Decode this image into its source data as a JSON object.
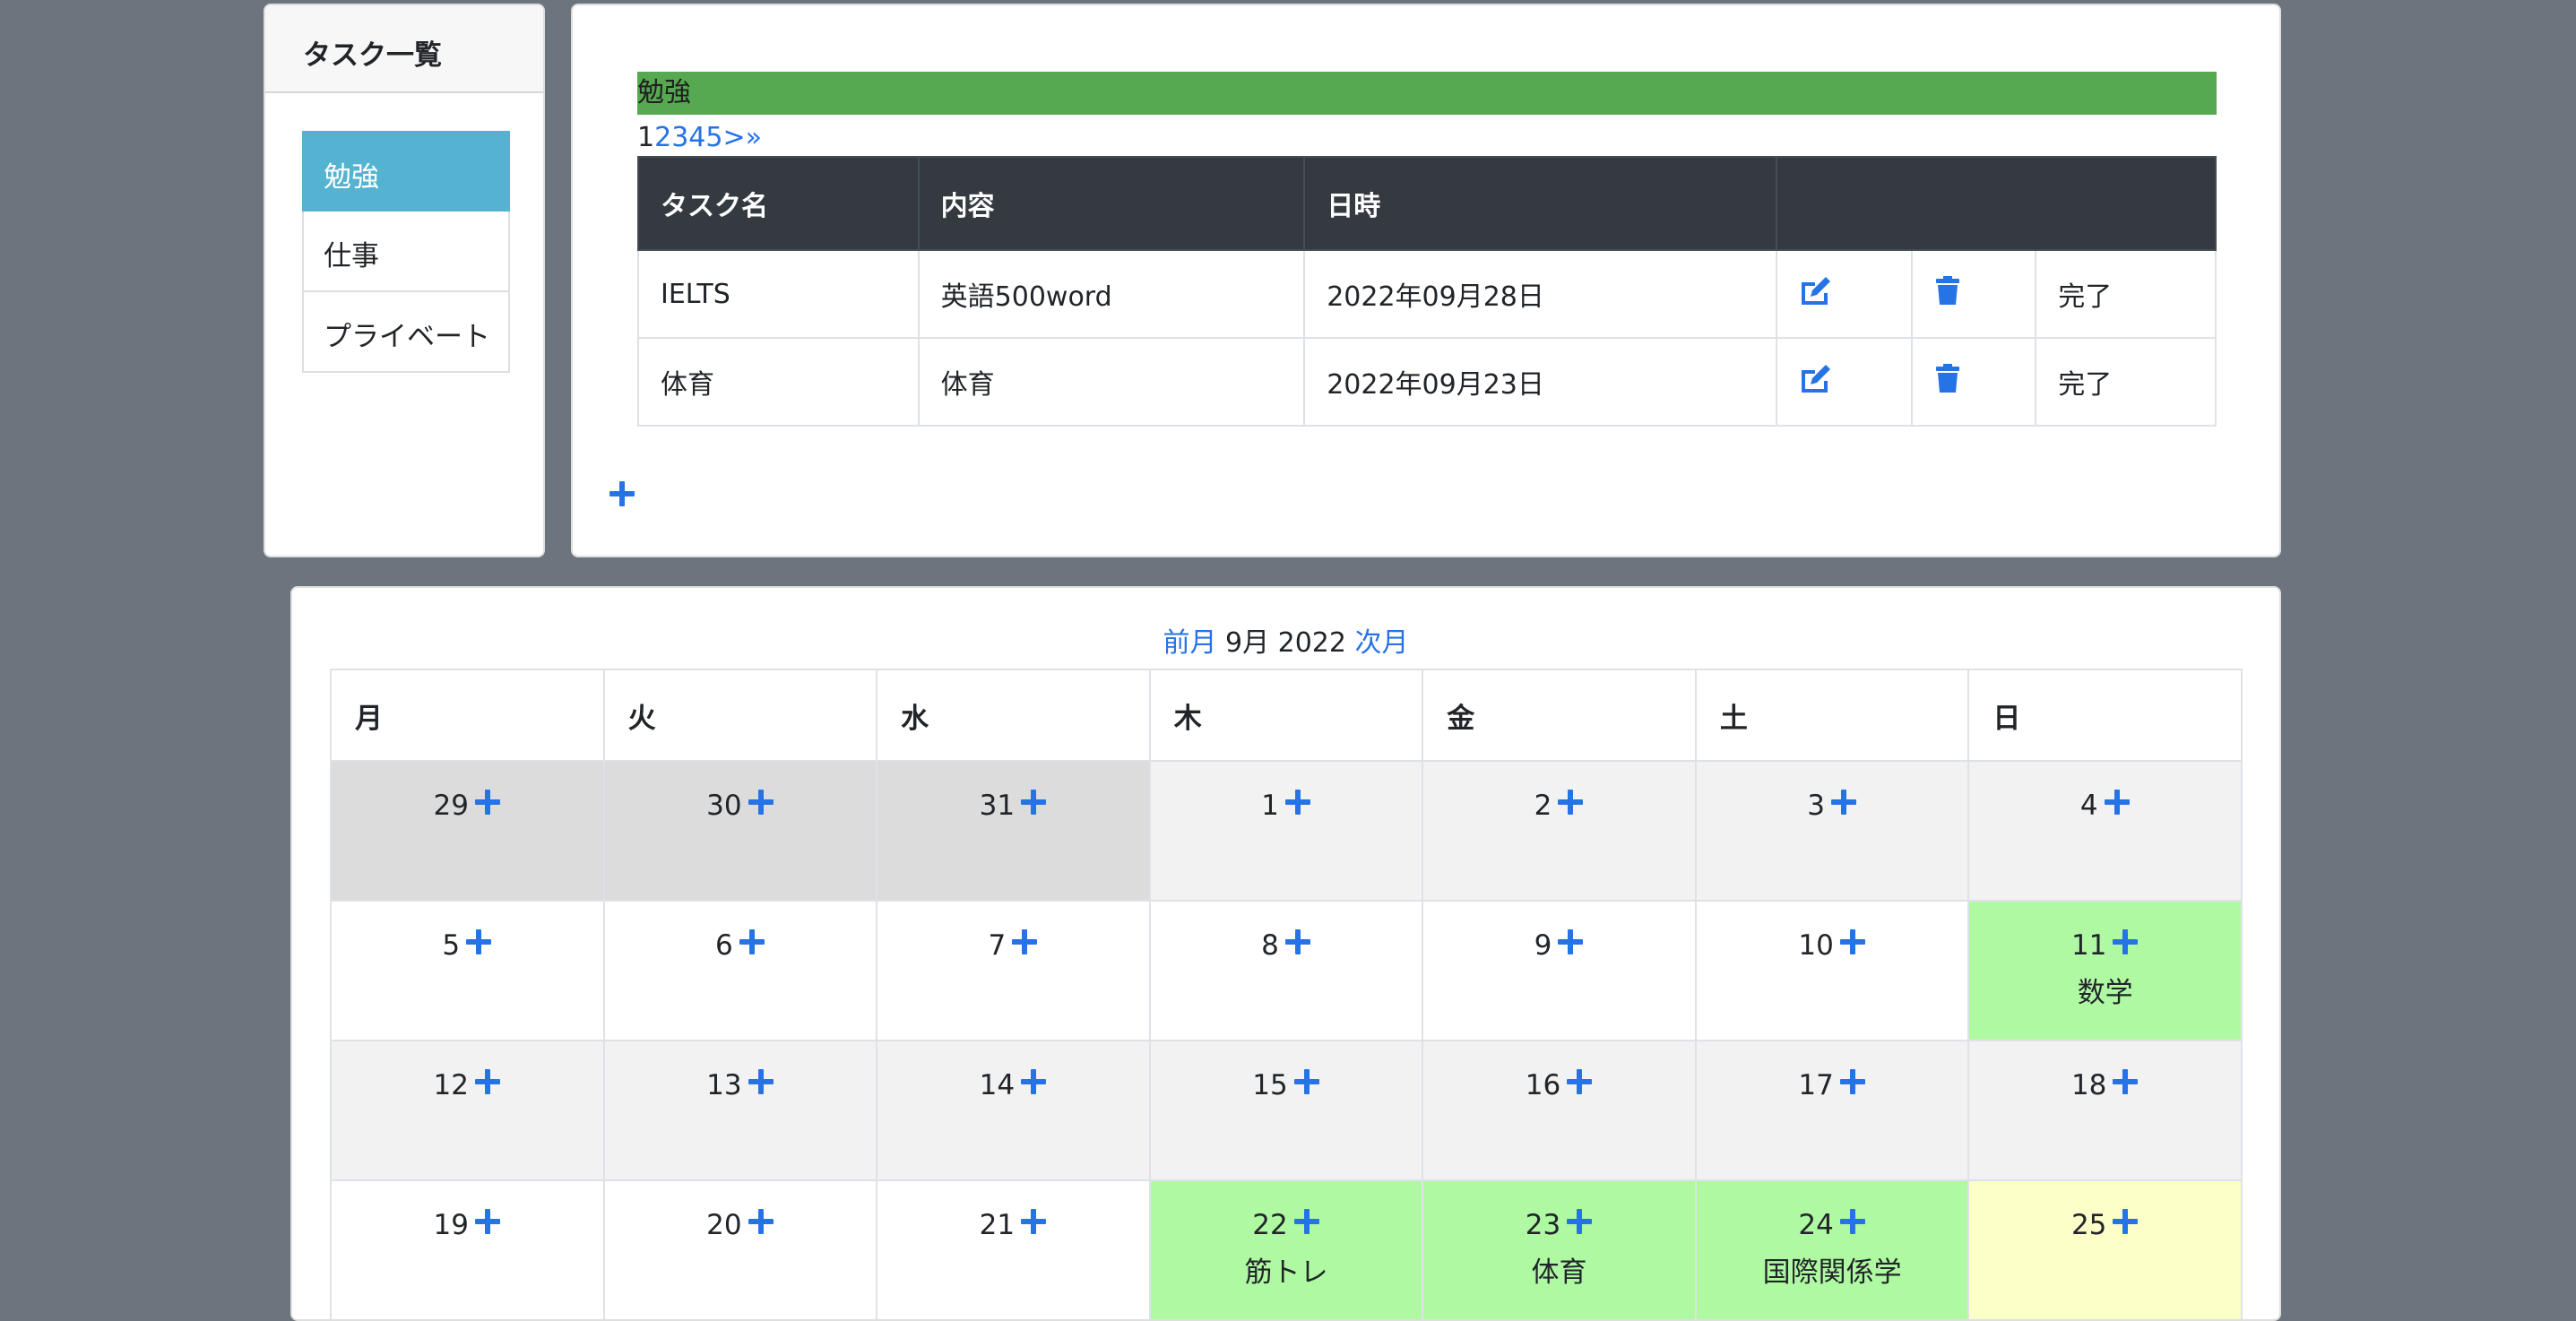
{
  "sidebar": {
    "title": "タスク一覧",
    "items": [
      {
        "label": "勉強",
        "active": true
      },
      {
        "label": "仕事",
        "active": false
      },
      {
        "label": "プライベート",
        "active": false
      }
    ]
  },
  "tasks": {
    "category": "勉強",
    "pager": {
      "current": "1",
      "pages": [
        "2",
        "3",
        "4",
        "5",
        ">"
      ],
      "last_icon": "double-chevron-right-icon"
    },
    "headers": [
      "タスク名",
      "内容",
      "日時",
      ""
    ],
    "rows": [
      {
        "name": "IELTS",
        "content": "英語500word",
        "date": "2022年09月28日",
        "done_label": "完了"
      },
      {
        "name": "体育",
        "content": "体育",
        "date": "2022年09月23日",
        "done_label": "完了"
      }
    ],
    "icons": {
      "edit": "edit-icon",
      "delete": "trash-icon",
      "add": "plus-icon"
    }
  },
  "calendar": {
    "prev_label": "前月",
    "current_label": "9月 2022",
    "next_label": "次月",
    "weekdays": [
      "月",
      "火",
      "水",
      "木",
      "金",
      "土",
      "日"
    ],
    "weeks": [
      [
        {
          "day": "29",
          "bg": "dark"
        },
        {
          "day": "30",
          "bg": "dark"
        },
        {
          "day": "31",
          "bg": "dark"
        },
        {
          "day": "1",
          "bg": "gray"
        },
        {
          "day": "2",
          "bg": "gray"
        },
        {
          "day": "3",
          "bg": "gray"
        },
        {
          "day": "4",
          "bg": "gray"
        }
      ],
      [
        {
          "day": "5",
          "bg": "white"
        },
        {
          "day": "6",
          "bg": "white"
        },
        {
          "day": "7",
          "bg": "white"
        },
        {
          "day": "8",
          "bg": "white"
        },
        {
          "day": "9",
          "bg": "white"
        },
        {
          "day": "10",
          "bg": "white"
        },
        {
          "day": "11",
          "bg": "green",
          "event": "数学"
        }
      ],
      [
        {
          "day": "12",
          "bg": "gray"
        },
        {
          "day": "13",
          "bg": "gray"
        },
        {
          "day": "14",
          "bg": "gray"
        },
        {
          "day": "15",
          "bg": "gray"
        },
        {
          "day": "16",
          "bg": "gray"
        },
        {
          "day": "17",
          "bg": "gray"
        },
        {
          "day": "18",
          "bg": "gray"
        }
      ],
      [
        {
          "day": "19",
          "bg": "white"
        },
        {
          "day": "20",
          "bg": "white"
        },
        {
          "day": "21",
          "bg": "white"
        },
        {
          "day": "22",
          "bg": "green",
          "event": "筋トレ"
        },
        {
          "day": "23",
          "bg": "green",
          "event": "体育"
        },
        {
          "day": "24",
          "bg": "green",
          "event": "国際関係学"
        },
        {
          "day": "25",
          "bg": "yellow"
        }
      ]
    ]
  },
  "colors": {
    "accent": "#2673e5",
    "active_item": "#54b3d1",
    "banner": "#56a950",
    "header_dark": "#343a40",
    "event_green": "#b0f9a3",
    "today_yellow": "#fdffc9"
  }
}
